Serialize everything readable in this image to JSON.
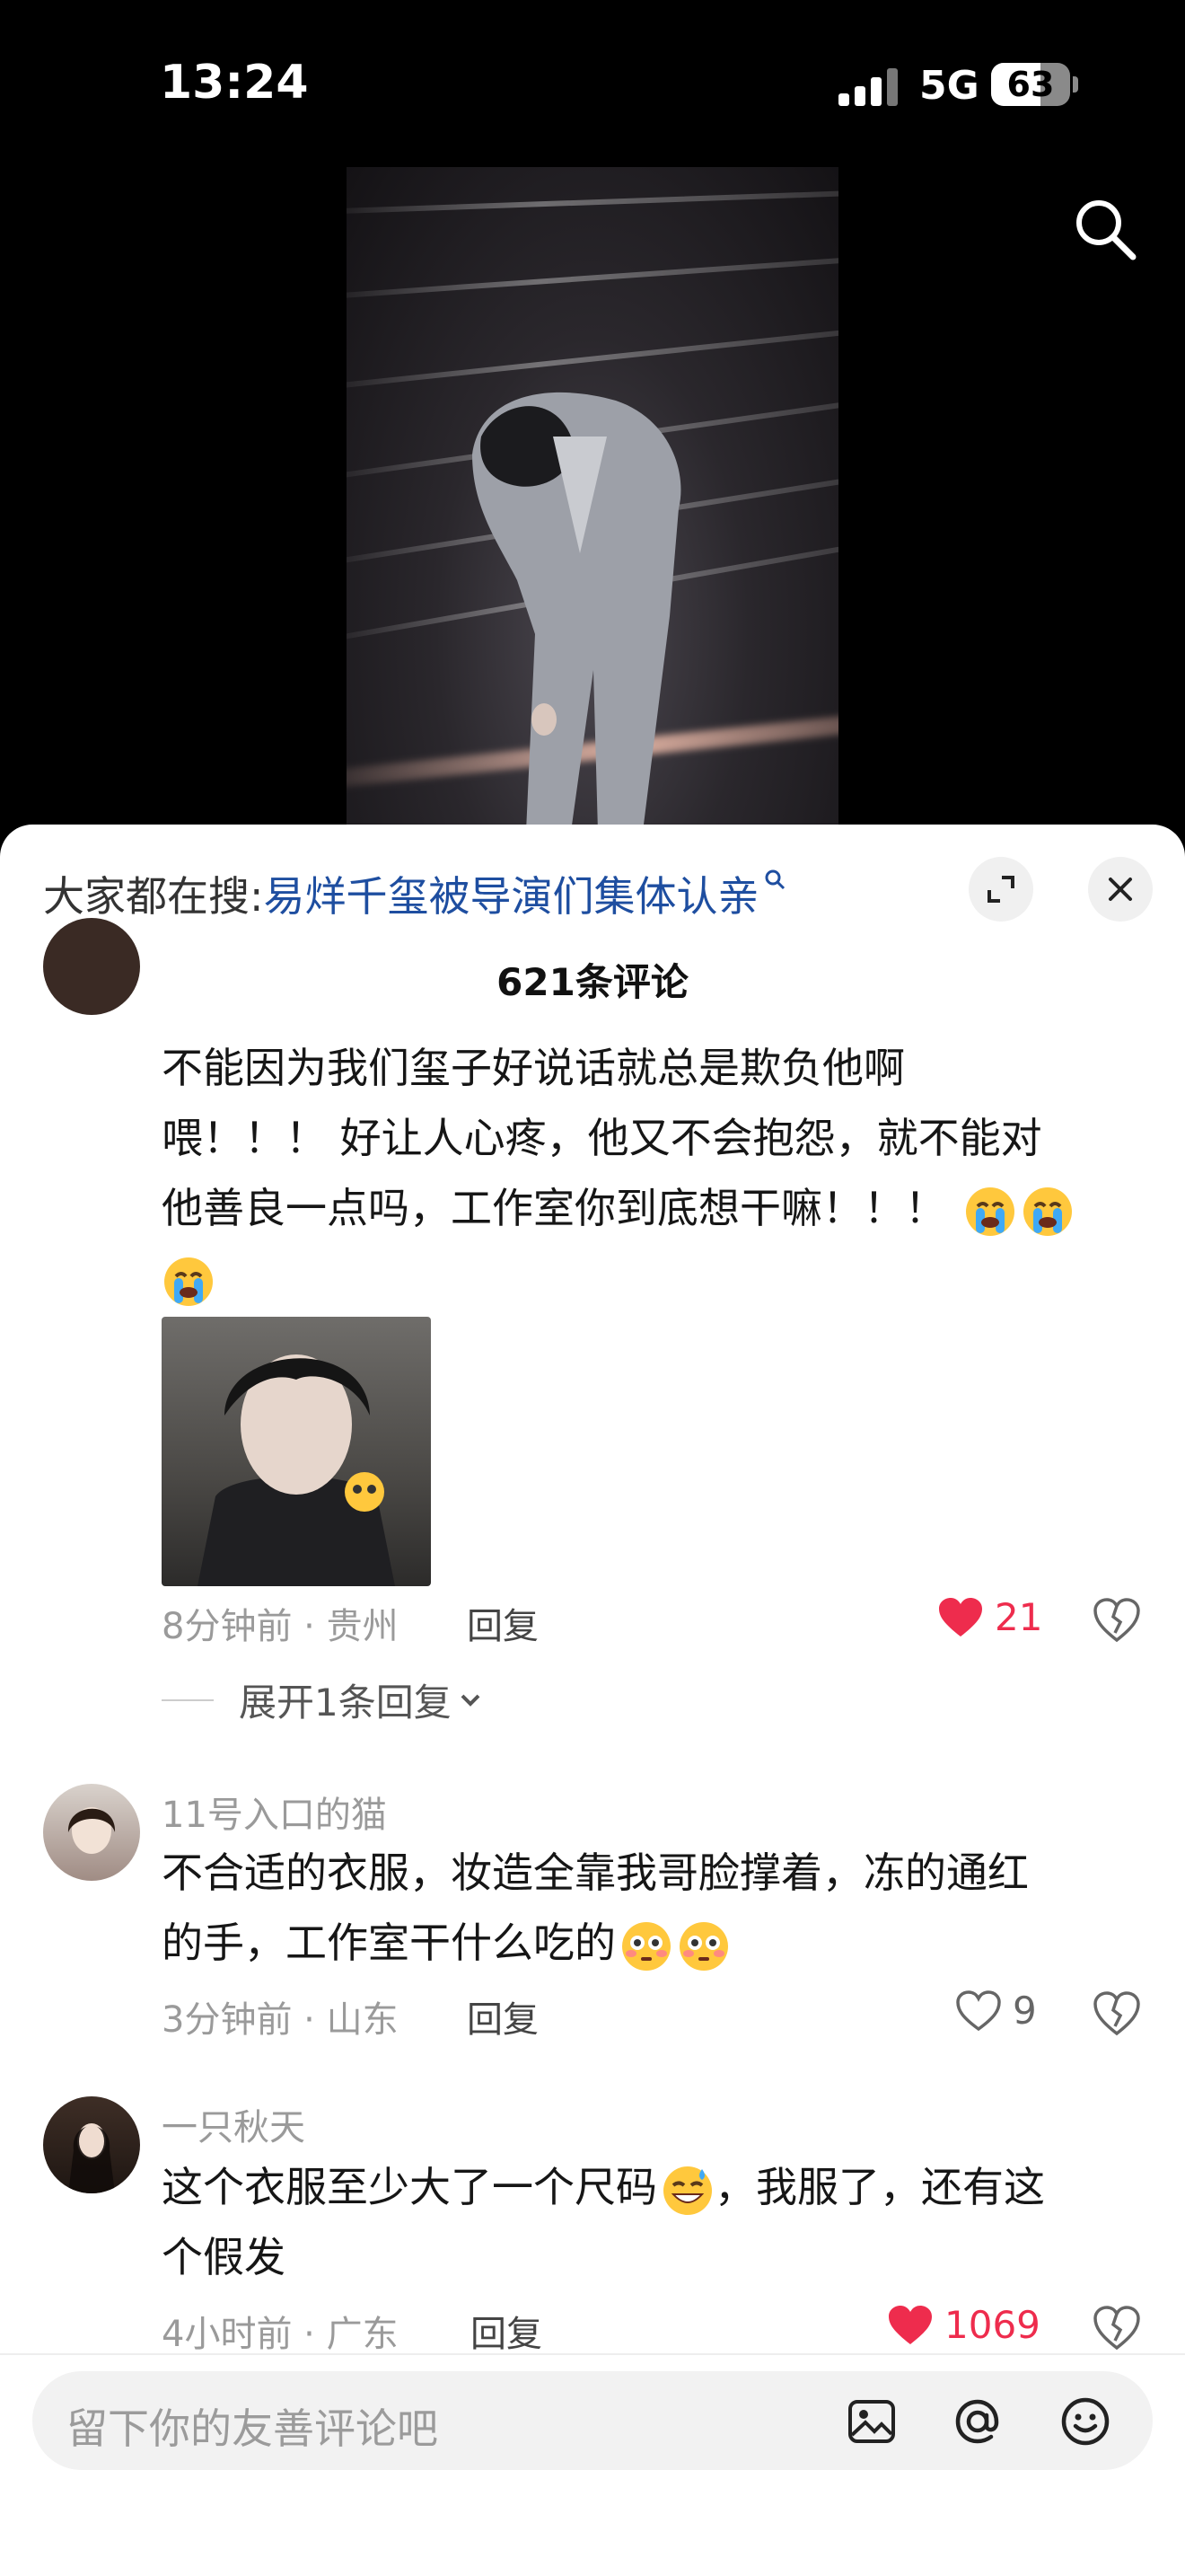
{
  "status": {
    "time": "13:24",
    "network": "5G",
    "battery": "63",
    "battery_level": 0.63
  },
  "sheet": {
    "search_prefix": "大家都在搜:",
    "search_keyword": "易烊千玺被导演们集体认亲",
    "comment_count_title": "621条评论"
  },
  "comments": [
    {
      "text_lines": [
        "不能因为我们玺子好说话就总是欺负他啊",
        "喂！！！ 好让人心疼，他又不会抱怨，就不能对",
        "他善良一点吗，工作室你到底想干嘛！！！"
      ],
      "time_location": "8分钟前 · 贵州",
      "reply": "回复",
      "likes": "21",
      "liked": true,
      "expand": "展开1条回复"
    },
    {
      "username": "11号入口的猫",
      "text_lines": [
        "不合适的衣服，妆造全靠我哥脸撑着，冻的通红",
        "的手，工作室干什么吃的"
      ],
      "time_location": "3分钟前 · 山东",
      "reply": "回复",
      "likes": "9",
      "liked": false
    },
    {
      "username": "一只秋天",
      "text_lines": [
        "这个衣服至少大了一个尺码",
        "，我服了，还有这",
        "个假发"
      ],
      "time_location": "4小时前 · 广东",
      "reply": "回复",
      "likes": "1069",
      "liked": true
    }
  ],
  "input": {
    "placeholder": "留下你的友善评论吧"
  },
  "icons": {
    "search": "search-icon",
    "expand_sheet": "expand-icon",
    "close": "close-icon",
    "like": "heart-icon",
    "dislike": "broken-heart-icon",
    "image": "image-icon",
    "mention": "at-icon",
    "emoji": "emoji-icon"
  },
  "colors": {
    "like_red": "#ee2c4d",
    "keyword_blue": "#1e4ea0"
  }
}
